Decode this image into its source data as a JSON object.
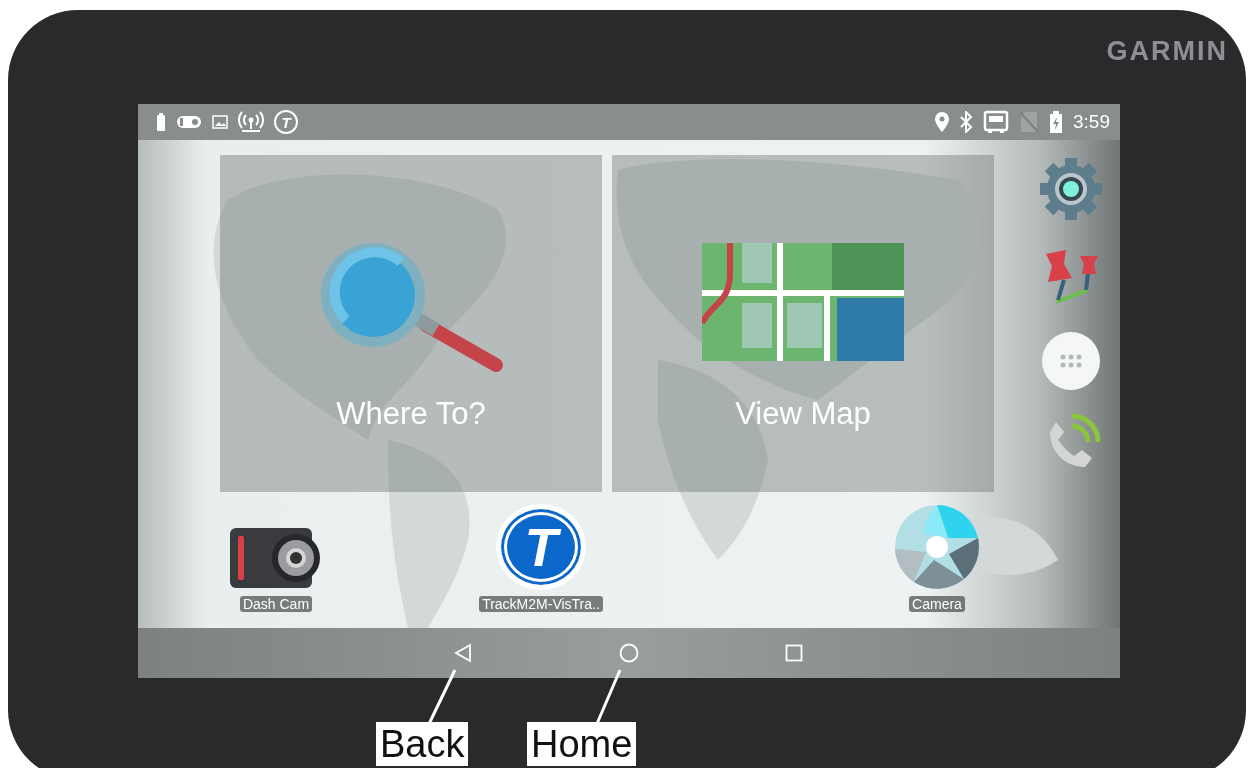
{
  "brand": "GARMIN",
  "status_bar": {
    "badge_letter": "T",
    "time": "3:59"
  },
  "tiles": [
    {
      "label": "Where To?",
      "kind": "search"
    },
    {
      "label": "View Map",
      "kind": "map"
    }
  ],
  "apps": [
    {
      "label": "Dash Cam",
      "kind": "dashcam"
    },
    {
      "label": "TrackM2M-VisTra..",
      "kind": "trackm2m",
      "icon_letter": "T"
    },
    {
      "label": "Camera",
      "kind": "camera"
    }
  ],
  "annotations": [
    {
      "label": "Back"
    },
    {
      "label": "Home"
    }
  ]
}
